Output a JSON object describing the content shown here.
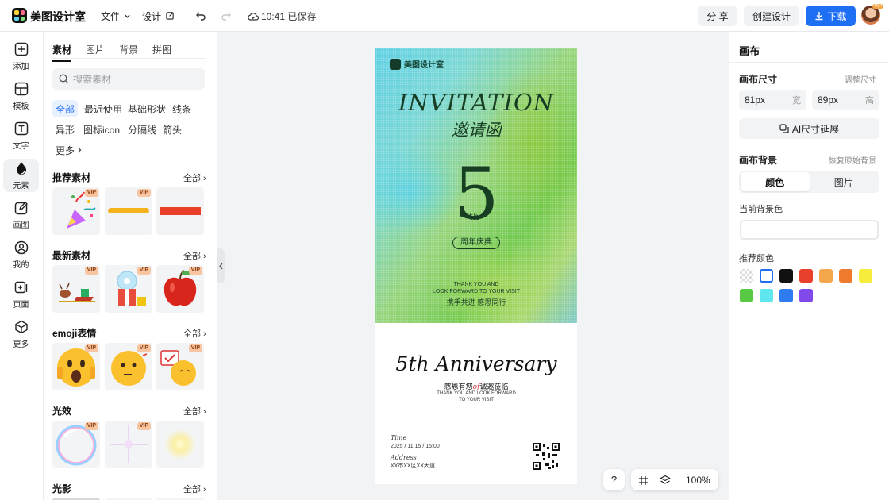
{
  "app": {
    "brand": "美图设计室",
    "menu_file": "文件",
    "menu_design": "设计",
    "save_status": "10:41 已保存",
    "share": "分 享",
    "create": "创建设计",
    "download": "下载",
    "avatar_badge": "VIP"
  },
  "rail": [
    {
      "label": "添加",
      "icon": "plus-square-icon"
    },
    {
      "label": "模板",
      "icon": "template-icon"
    },
    {
      "label": "文字",
      "icon": "text-icon"
    },
    {
      "label": "元素",
      "icon": "shapes-icon"
    },
    {
      "label": "画图",
      "icon": "draw-icon"
    },
    {
      "label": "我的",
      "icon": "user-icon"
    },
    {
      "label": "页面",
      "icon": "page-add-icon"
    },
    {
      "label": "更多",
      "icon": "more-cube-icon"
    }
  ],
  "panel": {
    "tabs": [
      "素材",
      "图片",
      "背景",
      "拼图"
    ],
    "search_placeholder": "搜索素材",
    "chips": [
      "全部",
      "最近使用",
      "基础形状",
      "线条",
      "异形",
      "图标icon",
      "分隔线",
      "箭头",
      "更多"
    ],
    "vip": "VIP",
    "sections": [
      {
        "title": "推荐素材",
        "all": "全部"
      },
      {
        "title": "最新素材",
        "all": "全部"
      },
      {
        "title": "emoji表情",
        "all": "全部"
      },
      {
        "title": "光效",
        "all": "全部"
      },
      {
        "title": "光影",
        "all": "全部"
      }
    ]
  },
  "poster": {
    "logo": "美图设计室",
    "title_en": "INVITATION",
    "title_cn": "邀请函",
    "number": "5",
    "suffix": "th",
    "celebration": "周年庆典",
    "thanks_en_1": "THANK YOU AND",
    "thanks_en_2": "LOOK FORWARD TO YOUR VISIT",
    "thanks_cn": "携手共进 感恩同行",
    "anniversary": "5th Anniversary",
    "anniv_cn_left": "感恩有您",
    "anniv_cn_of": "of",
    "anniv_cn_right": "诚邀莅临",
    "anniv_en_1": "THANK YOU AND LOOK FORWARD",
    "anniv_en_2": "TO YOUR VISIT",
    "time_label": "Time",
    "time_value": "2025 / 11.15 / 15:00",
    "address_label": "Address",
    "address_value": "XX市XX区XX大道"
  },
  "canvas": {
    "help": "?",
    "zoom": "100%"
  },
  "right": {
    "title": "画布",
    "size_label": "画布尺寸",
    "resize_link": "调整尺寸",
    "width_value": "81px",
    "width_unit": "宽",
    "height_value": "89px",
    "height_unit": "高",
    "ai_expand": "AI尺寸延展",
    "bg_label": "画布背景",
    "restore_link": "恢复原始背景",
    "seg_color": "颜色",
    "seg_image": "图片",
    "current_bg": "当前背景色",
    "recommend": "推荐颜色",
    "swatches": [
      "transparent",
      "#ffffff",
      "#111111",
      "#e8402b",
      "#f5a74b",
      "#ef7a2e",
      "#f6ec3c",
      "#58c943",
      "#5fe6ee",
      "#2f7cf0",
      "#8249ea"
    ]
  }
}
